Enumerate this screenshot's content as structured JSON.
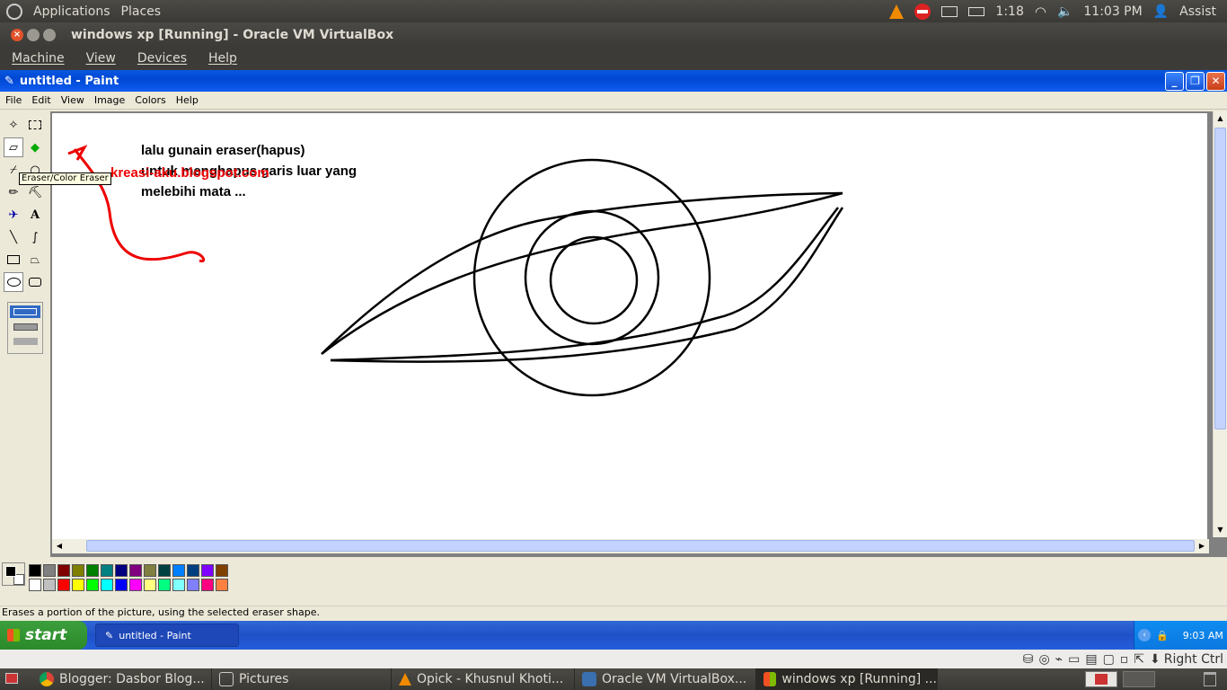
{
  "ubuntu_panel": {
    "menus": [
      "Applications",
      "Places"
    ],
    "battery": "1:18",
    "time": "11:03 PM",
    "user": "Assist"
  },
  "vbox": {
    "title": "windows xp [Running] - Oracle VM VirtualBox",
    "menus": [
      "Machine",
      "View",
      "Devices",
      "Help"
    ],
    "host_key": "Right Ctrl"
  },
  "paint": {
    "title": "untitled - Paint",
    "menus": [
      "File",
      "Edit",
      "View",
      "Image",
      "Colors",
      "Help"
    ],
    "tooltip": "Eraser/Color Eraser",
    "status": "Erases a portion of the picture, using the selected eraser shape.",
    "canvas_text": {
      "line1": "lalu gunain eraser(hapus)",
      "line2": "untuk menghapus garis luar yang",
      "line3": "melebihi mata ...",
      "blog": "kreasi-aku.blogspot.com"
    },
    "palette_top": [
      "#000000",
      "#808080",
      "#800000",
      "#808000",
      "#008000",
      "#008080",
      "#000080",
      "#800080",
      "#808040",
      "#004040",
      "#0080ff",
      "#004080",
      "#8000ff",
      "#804000"
    ],
    "palette_bottom": [
      "#ffffff",
      "#c0c0c0",
      "#ff0000",
      "#ffff00",
      "#00ff00",
      "#00ffff",
      "#0000ff",
      "#ff00ff",
      "#ffff80",
      "#00ff80",
      "#80ffff",
      "#8080ff",
      "#ff0080",
      "#ff8040"
    ]
  },
  "xp_taskbar": {
    "start": "start",
    "task": "untitled - Paint",
    "clock": "9:03 AM"
  },
  "ubuntu_tasks": [
    {
      "label": "Blogger: Dasbor Blog...",
      "icon": "chrome-icon"
    },
    {
      "label": "Pictures",
      "icon": "folder-icon"
    },
    {
      "label": "Opick - Khusnul Khoti...",
      "icon": "vlc-icon"
    },
    {
      "label": "Oracle VM VirtualBox...",
      "icon": "virtualbox-icon"
    },
    {
      "label": "windows xp [Running] ...",
      "icon": "paint-icon"
    }
  ]
}
